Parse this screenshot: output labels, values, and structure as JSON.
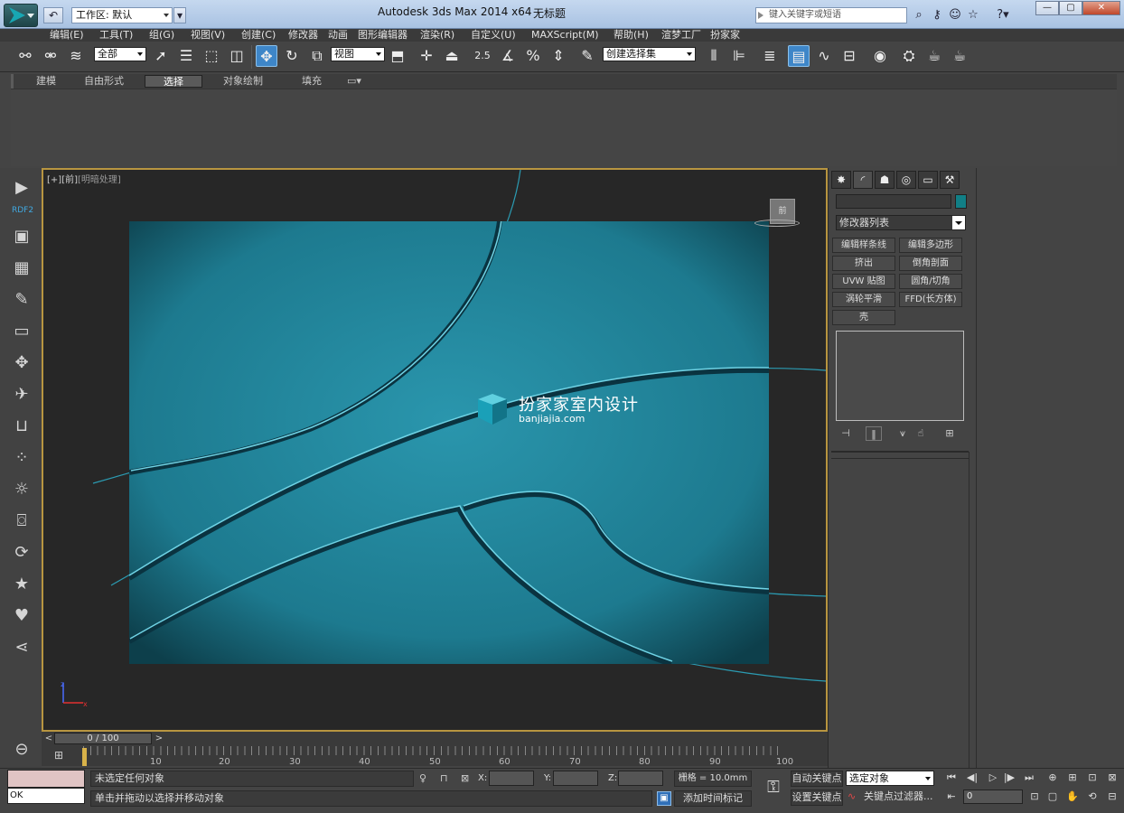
{
  "app": {
    "title": "Autodesk 3ds Max  2014 x64",
    "document": "无标题",
    "workspace": "工作区: 默认",
    "search_placeholder": "键入关键字或短语"
  },
  "menu": [
    "编辑(E)",
    "工具(T)",
    "组(G)",
    "视图(V)",
    "创建(C)",
    "修改器",
    "动画",
    "图形编辑器",
    "渲染(R)",
    "自定义(U)",
    "MAXScript(M)",
    "帮助(H)",
    "渲梦工厂",
    "扮家家"
  ],
  "toolbar": {
    "selection_filter": "全部",
    "ref_coord": "视图",
    "named_sel_set": "创建选择集",
    "snap_label": "2.5"
  },
  "ribbon": {
    "tabs": [
      "建模",
      "自由形式",
      "选择",
      "对象绘制",
      "填充"
    ],
    "active_tab": "选择"
  },
  "leftbar": {
    "plugin_label": "RDF2"
  },
  "viewport": {
    "label_plus": "[+]",
    "label_view": "[前]",
    "label_shading": "[明暗处理]",
    "viewcube_label": "前",
    "watermark_cn": "扮家家室内设计",
    "watermark_en": "banjiajia.com",
    "panel_color": "#1f7d91"
  },
  "timeline": {
    "counter": "0 / 100",
    "ticks": [
      "10",
      "20",
      "30",
      "40",
      "50",
      "60",
      "70",
      "80",
      "90",
      "100"
    ]
  },
  "command_panel": {
    "modifier_list": "修改器列表",
    "modifiers": [
      "编辑样条线",
      "编辑多边形",
      "挤出",
      "倒角剖面",
      "UVW 贴图",
      "圆角/切角",
      "涡轮平滑",
      "FFD(长方体)",
      "壳"
    ],
    "object_color": "#117f86"
  },
  "status": {
    "maxscript_out": "OK",
    "prompt1": "未选定任何对象",
    "prompt2": "单击并拖动以选择并移动对象",
    "x_label": "X:",
    "y_label": "Y:",
    "z_label": "Z:",
    "grid": "栅格 = 10.0mm",
    "add_time_tag": "添加时间标记",
    "auto_key": "自动关键点",
    "set_key": "设置关键点",
    "sel_filter": "选定对象",
    "key_filters": "关键点过滤器...",
    "frame": "0"
  }
}
